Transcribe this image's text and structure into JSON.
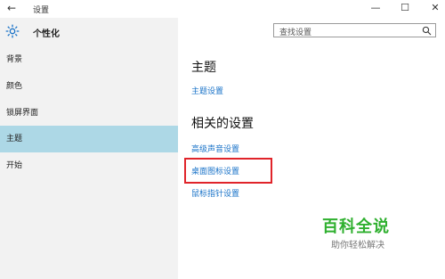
{
  "titlebar": {
    "back_icon": "back-arrow-icon",
    "title": "设置",
    "minimize_glyph": "—",
    "maximize_glyph": "☐",
    "close_glyph": "✕"
  },
  "sidebar": {
    "icon": "gear-icon",
    "title": "个性化",
    "items": [
      {
        "label": "背景"
      },
      {
        "label": "颜色"
      },
      {
        "label": "锁屏界面"
      },
      {
        "label": "主题",
        "active": true
      },
      {
        "label": "开始"
      }
    ],
    "active_color": "#add8e6"
  },
  "search": {
    "placeholder": "查找设置",
    "icon": "search-icon"
  },
  "main": {
    "section_theme": "主题",
    "theme_settings_link": "主题设置",
    "section_related": "相关的设置",
    "links": [
      {
        "label": "高级声音设置"
      },
      {
        "label": "桌面图标设置",
        "highlighted": true
      },
      {
        "label": "鼠标指针设置"
      }
    ],
    "link_color": "#1a73c8",
    "highlight_color": "#e0242a"
  },
  "watermark": {
    "title": "百科全说",
    "subtitle": "助你轻松解决"
  }
}
